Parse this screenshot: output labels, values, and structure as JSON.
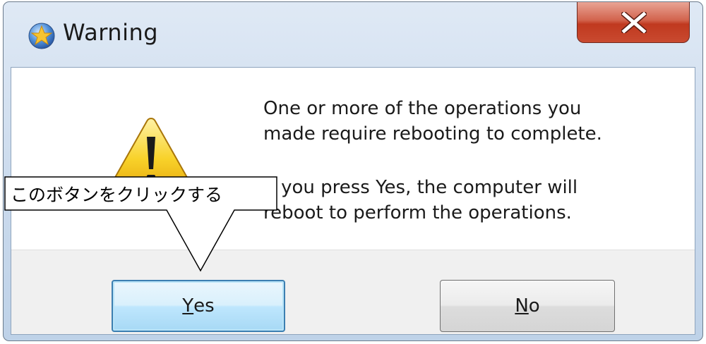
{
  "window": {
    "title": "Warning"
  },
  "message": {
    "paragraph1": "One or more of the operations you\nmade require rebooting to complete.",
    "paragraph2": "If you press Yes, the computer will\nreboot to perform the operations."
  },
  "buttons": {
    "yes": {
      "mnemonic": "Y",
      "rest": "es"
    },
    "no": {
      "mnemonic": "N",
      "rest": "o"
    }
  },
  "annotation": {
    "callout_text": "このボタンをクリックする"
  },
  "icons": {
    "app": "app-icon",
    "close": "close-icon",
    "warning": "warning-icon"
  },
  "colors": {
    "close_button": "#c94a30",
    "default_button_border": "#3c7fb1",
    "warning_yellow": "#f8d22a"
  }
}
